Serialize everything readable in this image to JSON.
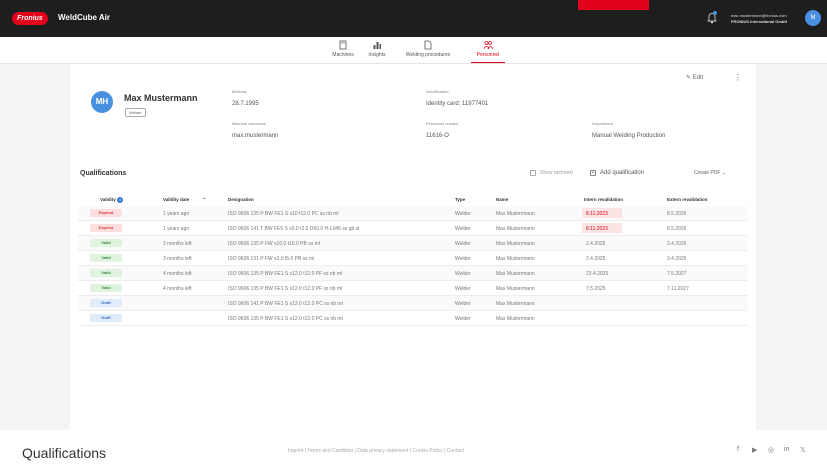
{
  "header": {
    "brand": "Fronius",
    "app_title": "WeldCube Air",
    "user_email": "max.mustermann@fronius.com",
    "user_org": "FRONIUS International GmbH",
    "user_initials": "M",
    "accent": "#e2001a"
  },
  "nav": {
    "tabs": [
      {
        "label": "Machines",
        "icon": "machine-icon"
      },
      {
        "label": "Insights",
        "icon": "bar-chart-icon"
      },
      {
        "label": "Welding procedures",
        "icon": "document-icon"
      },
      {
        "label": "Personnel",
        "icon": "people-icon",
        "active": true
      }
    ]
  },
  "profile": {
    "initials": "MH",
    "name": "Max Mustermann",
    "role": "Welder",
    "edit_label": "Edit",
    "fields": {
      "birthday_label": "Birthday",
      "birthday": "28.7.1995",
      "identification_label": "Identification",
      "identification": "Identity card: 11977401",
      "machine_username_label": "Machine username",
      "machine_username": "max.mustermann",
      "personnel_number_label": "Personnel number",
      "personnel_number": "11616-O",
      "department_label": "Department",
      "department": "Manual Welding Production"
    }
  },
  "qualifications": {
    "title": "Qualifications",
    "show_archived": "Show archived",
    "add_label": "Add qualification",
    "create_pdf": "Create PDF",
    "columns": {
      "validity": "Validity",
      "validity_date": "Validity date",
      "designation": "Designation",
      "type": "Type",
      "name": "Name",
      "intern": "Intern revalidation",
      "extern": "Extern revalidation"
    },
    "rows": [
      {
        "status": "Expired",
        "status_bg": "#fcdede",
        "status_fg": "#d63a3a",
        "date": "1 years ago",
        "designation": "ISO 9606 135 P BW FE1 S s10 t12.0 PC ss nb ml",
        "type": "Welder",
        "name": "Max Mustermann",
        "intern": "8.11.2023",
        "extern": "8.5.2026",
        "intern_highlight": true
      },
      {
        "status": "Expired",
        "status_bg": "#fcdede",
        "status_fg": "#d63a3a",
        "date": "1 years ago",
        "designation": "ISO 9606 141 T BW FE5 S s0.0 t2.0 D60.0 H-L045 ss gb sl",
        "type": "Welder",
        "name": "Max Mustermann",
        "intern": "8.11.2023",
        "extern": "8.5.2026",
        "intern_highlight": true
      },
      {
        "status": "Valid",
        "status_bg": "#dff3df",
        "status_fg": "#3a8a3a",
        "date": "3 months left",
        "designation": "ISO 9606 135 P FW s10.0 t10.0 PB ss ml",
        "type": "Welder",
        "name": "Max Mustermann",
        "intern": "2.4.2025",
        "extern": "3.4.2026"
      },
      {
        "status": "Valid",
        "status_bg": "#dff3df",
        "status_fg": "#3a8a3a",
        "date": "3 months left",
        "designation": "ISO 9606 131 P FW s3.0 t5.0 PB ss ml",
        "type": "Welder",
        "name": "Max Mustermann",
        "intern": "2.4.2025",
        "extern": "3.4.2025"
      },
      {
        "status": "Valid",
        "status_bg": "#dff3df",
        "status_fg": "#3a8a3a",
        "date": "4 months left",
        "designation": "ISO 9606 135 P BW FE1 S s12.0 t12.0 PF ss nb ml",
        "type": "Welder",
        "name": "Max Mustermann",
        "intern": "23.4.2025",
        "extern": "7.5.2027"
      },
      {
        "status": "Valid",
        "status_bg": "#dff3df",
        "status_fg": "#3a8a3a",
        "date": "4 months left",
        "designation": "ISO 9606 135 P BW FE1 S s12.0 t12.0 PF ss nb ml",
        "type": "Welder",
        "name": "Max Mustermann",
        "intern": "7.5.2025",
        "extern": "7.11.2027"
      },
      {
        "status": "Draft",
        "status_bg": "#e1ecfb",
        "status_fg": "#3a6fc4",
        "date": "",
        "designation": "ISO 9606 141 P BW FE1 S s12.0 t12.0 PC ss nb ml",
        "type": "Welder",
        "name": "Max Mustermann",
        "intern": "",
        "extern": ""
      },
      {
        "status": "Draft",
        "status_bg": "#e1ecfb",
        "status_fg": "#3a6fc4",
        "date": "",
        "designation": "ISO 9606 135 P BW FE1 S s12.0 t12.0 PC ss nb ml",
        "type": "Welder",
        "name": "Max Mustermann",
        "intern": "",
        "extern": ""
      }
    ]
  },
  "footer": {
    "title": "Qualifications",
    "links": "Imprint  |  Terms and Condition  |  Data privacy statement  |  Cookie Policy  |  Contact",
    "social": [
      "f",
      "▶",
      "◎",
      "in",
      "𝕏"
    ]
  }
}
